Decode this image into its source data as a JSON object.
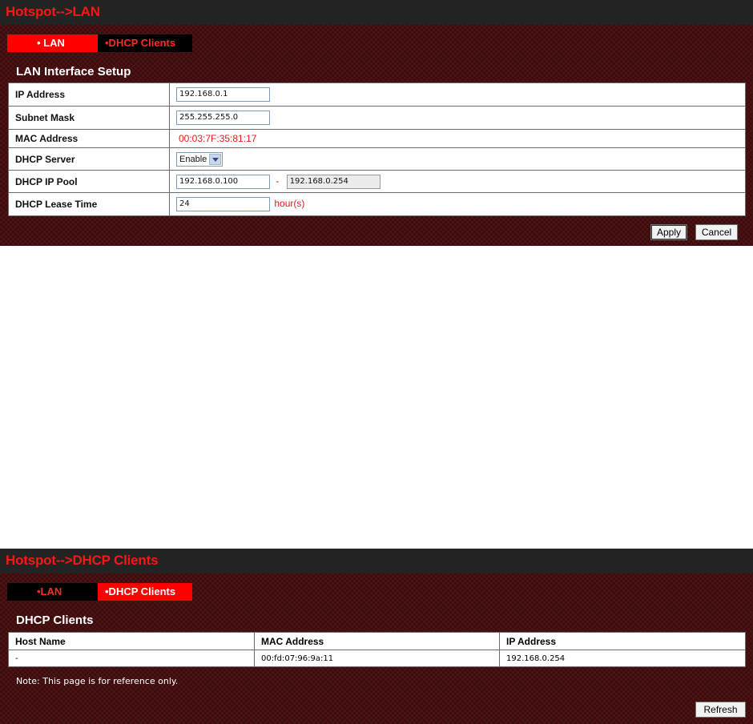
{
  "lan_panel": {
    "title": "Hotspot-->LAN",
    "tabs": [
      {
        "label": "• LAN"
      },
      {
        "label": "•DHCP Clients"
      }
    ],
    "section_title": "LAN Interface Setup",
    "rows": {
      "ip_address": {
        "label": "IP Address",
        "value": "192.168.0.1"
      },
      "subnet_mask": {
        "label": "Subnet Mask",
        "value": "255.255.255.0"
      },
      "mac_address": {
        "label": "MAC Address",
        "value": "00:03:7F:35:81:17"
      },
      "dhcp_server": {
        "label": "DHCP Server",
        "value": "Enable"
      },
      "dhcp_ip_pool": {
        "label": "DHCP IP Pool",
        "start": "192.168.0.100",
        "separator": "-",
        "end": "192.168.0.254"
      },
      "dhcp_lease_time": {
        "label": "DHCP Lease Time",
        "value": "24",
        "unit": "hour(s)"
      }
    },
    "buttons": {
      "apply": "Apply",
      "cancel": "Cancel"
    }
  },
  "dhcp_panel": {
    "title": "Hotspot-->DHCP Clients",
    "tabs": [
      {
        "label": "•LAN"
      },
      {
        "label": "•DHCP Clients"
      }
    ],
    "section_title": "DHCP Clients",
    "columns": [
      "Host Name",
      "MAC Address",
      "IP Address"
    ],
    "rows": [
      {
        "host_name": "-",
        "mac": "00:fd:07:96:9a:11",
        "ip": "192.168.0.254"
      }
    ],
    "note": "Note:  This page is for reference only.",
    "buttons": {
      "refresh": "Refresh"
    }
  },
  "colors": {
    "title_red": "#ff1414",
    "active_tab": "#ff0000",
    "background_maroon": "#4e1212",
    "titlebar": "#232323"
  }
}
